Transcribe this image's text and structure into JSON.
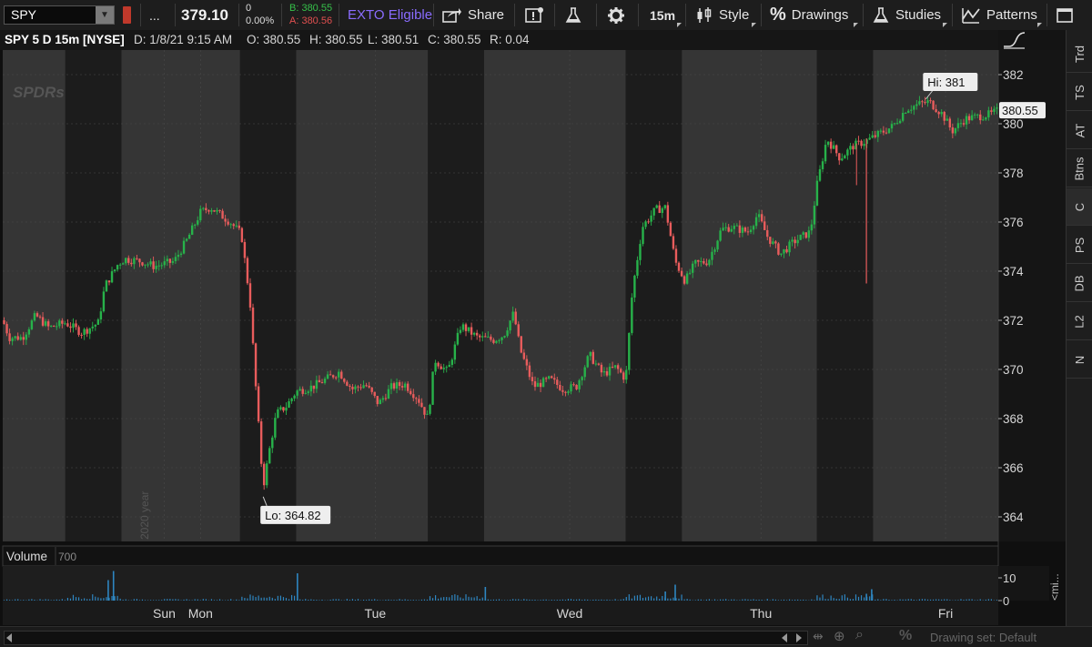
{
  "toolbar": {
    "symbol": "SPY",
    "more_label": "...",
    "last_price": "379.10",
    "net_change": "0",
    "pct_change": "0.00%",
    "bid": "B: 380.55",
    "ask": "A: 380.56",
    "exto_label": "EXTO Eligible",
    "share_label": "Share",
    "timeframe_label": "15m",
    "style_label": "Style",
    "drawings_label": "Drawings",
    "studies_label": "Studies",
    "patterns_label": "Patterns"
  },
  "header": {
    "title": "SPY 5 D 15m [NYSE]",
    "date": "D: 1/8/21 9:15 AM",
    "open": "O: 380.55",
    "high": "H: 380.55",
    "low": "L: 380.51",
    "close": "C: 380.55",
    "range": "R: 0.04"
  },
  "sidebar": {
    "tabs": [
      "Trd",
      "TS",
      "AT",
      "Btns",
      "C",
      "PS",
      "DB",
      "L2",
      "N"
    ]
  },
  "volume_panel": {
    "label": "Volume",
    "value": "700",
    "axis_ticks": [
      {
        "value": 10,
        "label": "10"
      },
      {
        "value": 0,
        "label": "0"
      }
    ],
    "unit_label": "<mi..."
  },
  "bottom_bar": {
    "drawing_set": "Drawing set: Default"
  },
  "chart_data": {
    "type": "candlestick",
    "symbol": "SPY",
    "aggregation": "15m",
    "period": "5 D",
    "watermark": "SPDRs",
    "year_label": "2020 year",
    "x_labels": [
      {
        "label": "Sun",
        "pos": 2.45
      },
      {
        "label": "Mon",
        "pos": 3.0
      },
      {
        "label": "Tue",
        "pos": 5.65
      },
      {
        "label": "Wed",
        "pos": 8.6
      },
      {
        "label": "Thu",
        "pos": 11.5
      },
      {
        "label": "Fri",
        "pos": 14.3
      }
    ],
    "ylim": [
      363,
      383
    ],
    "y_ticks": [
      364,
      366,
      368,
      370,
      372,
      374,
      376,
      378,
      380,
      382
    ],
    "last_price_label": "380.55",
    "high_marker": {
      "label": "Hi: 381",
      "value": 381.0,
      "pos": 14.0
    },
    "low_marker": {
      "label": "Lo: 364.82",
      "value": 364.82,
      "pos": 3.95
    },
    "bands": [
      {
        "start": 0.0,
        "end": 0.95,
        "kind": "regular"
      },
      {
        "start": 0.95,
        "end": 1.8,
        "kind": "extended"
      },
      {
        "start": 1.8,
        "end": 3.6,
        "kind": "regular"
      },
      {
        "start": 3.6,
        "end": 4.45,
        "kind": "extended"
      },
      {
        "start": 4.45,
        "end": 6.45,
        "kind": "regular"
      },
      {
        "start": 6.45,
        "end": 7.3,
        "kind": "extended"
      },
      {
        "start": 7.3,
        "end": 9.45,
        "kind": "regular"
      },
      {
        "start": 9.45,
        "end": 10.3,
        "kind": "extended"
      },
      {
        "start": 10.3,
        "end": 12.35,
        "kind": "regular"
      },
      {
        "start": 12.35,
        "end": 13.2,
        "kind": "extended"
      },
      {
        "start": 13.2,
        "end": 15.1,
        "kind": "regular"
      }
    ],
    "price_path": [
      [
        0.0,
        372.0
      ],
      [
        0.1,
        371.3
      ],
      [
        0.3,
        371.3
      ],
      [
        0.5,
        372.2
      ],
      [
        0.7,
        371.7
      ],
      [
        0.95,
        371.9
      ],
      [
        1.2,
        371.5
      ],
      [
        1.45,
        371.9
      ],
      [
        1.55,
        373.4
      ],
      [
        1.75,
        374.3
      ],
      [
        1.85,
        374.5
      ],
      [
        2.1,
        374.4
      ],
      [
        2.3,
        374.2
      ],
      [
        2.6,
        374.4
      ],
      [
        2.8,
        375.3
      ],
      [
        3.0,
        376.4
      ],
      [
        3.15,
        376.6
      ],
      [
        3.45,
        376.0
      ],
      [
        3.62,
        375.5
      ],
      [
        3.75,
        372.8
      ],
      [
        3.85,
        368.8
      ],
      [
        3.95,
        365.2
      ],
      [
        4.05,
        366.8
      ],
      [
        4.15,
        368.2
      ],
      [
        4.3,
        368.5
      ],
      [
        4.45,
        369.1
      ],
      [
        4.7,
        369.3
      ],
      [
        4.9,
        369.6
      ],
      [
        5.1,
        369.9
      ],
      [
        5.3,
        369.2
      ],
      [
        5.5,
        369.4
      ],
      [
        5.7,
        368.6
      ],
      [
        5.9,
        369.3
      ],
      [
        6.1,
        369.4
      ],
      [
        6.3,
        368.8
      ],
      [
        6.45,
        368.0
      ],
      [
        6.55,
        370.4
      ],
      [
        6.75,
        369.9
      ],
      [
        6.95,
        371.8
      ],
      [
        7.2,
        371.3
      ],
      [
        7.45,
        371.2
      ],
      [
        7.6,
        371.4
      ],
      [
        7.75,
        372.3
      ],
      [
        7.85,
        370.8
      ],
      [
        8.05,
        369.3
      ],
      [
        8.3,
        369.6
      ],
      [
        8.5,
        369.2
      ],
      [
        8.7,
        369.3
      ],
      [
        8.9,
        370.6
      ],
      [
        9.1,
        369.8
      ],
      [
        9.3,
        370.1
      ],
      [
        9.45,
        369.6
      ],
      [
        9.55,
        373.2
      ],
      [
        9.7,
        375.8
      ],
      [
        9.9,
        376.5
      ],
      [
        10.05,
        376.6
      ],
      [
        10.2,
        374.4
      ],
      [
        10.35,
        373.6
      ],
      [
        10.5,
        374.3
      ],
      [
        10.7,
        374.4
      ],
      [
        10.9,
        375.7
      ],
      [
        11.05,
        375.8
      ],
      [
        11.3,
        375.6
      ],
      [
        11.45,
        376.3
      ],
      [
        11.6,
        375.4
      ],
      [
        11.8,
        374.7
      ],
      [
        12.0,
        375.2
      ],
      [
        12.25,
        375.6
      ],
      [
        12.35,
        377.5
      ],
      [
        12.5,
        379.4
      ],
      [
        12.7,
        378.6
      ],
      [
        12.9,
        379.1
      ],
      [
        13.1,
        379.3
      ],
      [
        13.3,
        379.6
      ],
      [
        13.5,
        379.9
      ],
      [
        13.7,
        380.6
      ],
      [
        13.9,
        380.8
      ],
      [
        14.05,
        380.9
      ],
      [
        14.25,
        380.4
      ],
      [
        14.4,
        379.7
      ],
      [
        14.6,
        380.2
      ],
      [
        14.8,
        380.3
      ],
      [
        15.0,
        380.4
      ],
      [
        15.1,
        380.55
      ]
    ],
    "volume_spikes": [
      {
        "pos": 1.6,
        "value": 9
      },
      {
        "pos": 1.68,
        "value": 13
      },
      {
        "pos": 4.47,
        "value": 12
      },
      {
        "pos": 7.32,
        "value": 6
      },
      {
        "pos": 10.05,
        "value": 4
      },
      {
        "pos": 10.2,
        "value": 7
      },
      {
        "pos": 13.1,
        "value": 3
      },
      {
        "pos": 13.18,
        "value": 5
      }
    ]
  },
  "colors": {
    "up": "#27b24a",
    "down": "#e85c5c",
    "regular_band": "#353535",
    "extended_band": "#1c1c1c",
    "volume": "#2e86c1",
    "exto": "#8a6cff",
    "bid": "#36c04a",
    "ask": "#e05050"
  }
}
